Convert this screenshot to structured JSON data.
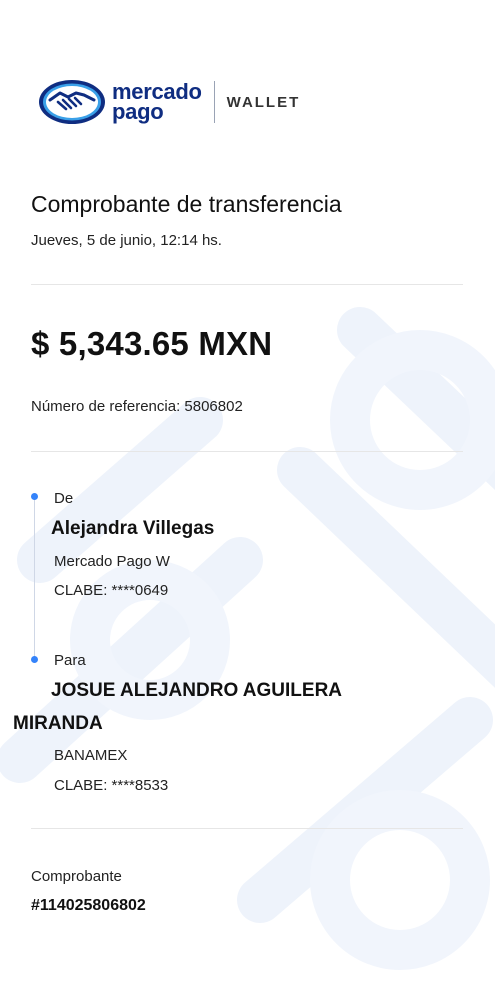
{
  "header": {
    "brand_line1": "mercado",
    "brand_line2": "pago",
    "product": "WALLET",
    "brand_color": "#0f2d81",
    "accent_color": "#3483fa",
    "logo_icon": "handshake-icon"
  },
  "receipt": {
    "title": "Comprobante de transferencia",
    "date": "Jueves, 5 de junio, 12:14 hs.",
    "amount": "$ 5,343.65 MXN",
    "reference": "Número de referencia: 5806802"
  },
  "from": {
    "label": "De",
    "name": "Alejandra Villegas",
    "bank": "Mercado Pago W",
    "clabe": "CLABE: ****0649"
  },
  "to": {
    "label": "Para",
    "name": "JOSUE ALEJANDRO AGUILERA MIRANDA",
    "bank": "BANAMEX",
    "clabe": "CLABE: ****8533"
  },
  "footer": {
    "label": "Comprobante",
    "number": "#114025806802"
  }
}
